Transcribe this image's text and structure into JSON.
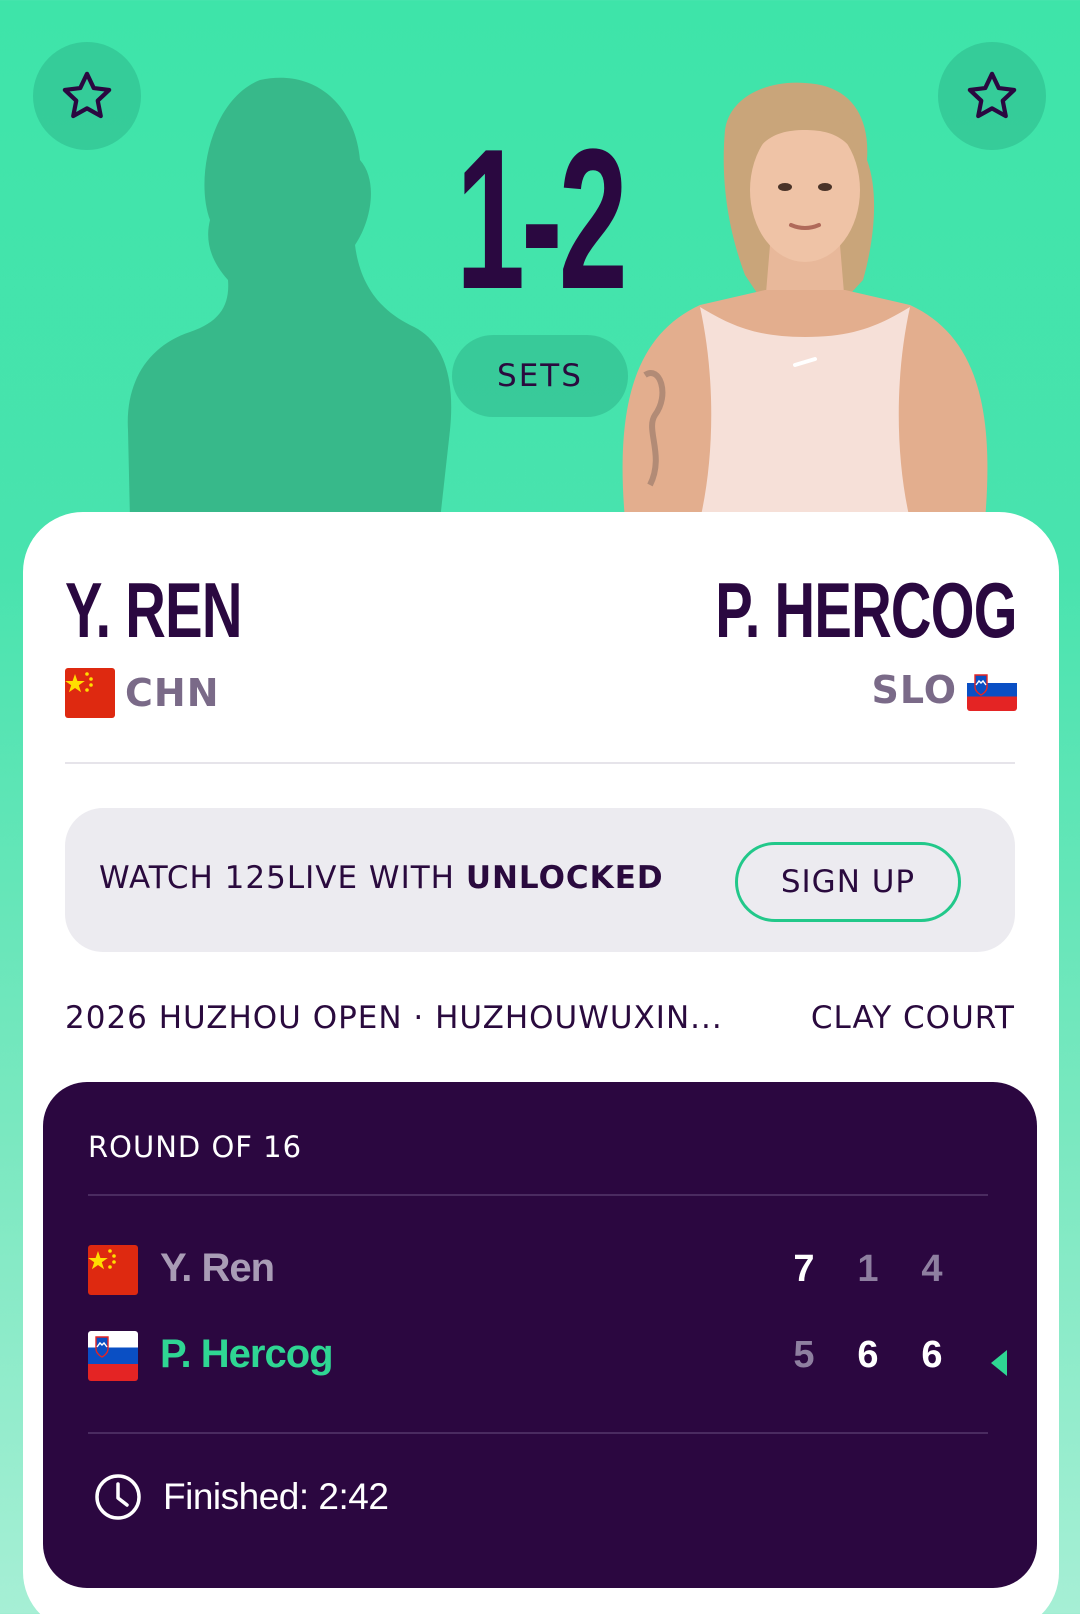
{
  "header": {
    "set_score": "1-2",
    "sets_label": "SETS"
  },
  "players": {
    "left": {
      "name": "Y. REN",
      "country_code": "CHN",
      "flag": "china-flag"
    },
    "right": {
      "name": "P. HERCOG",
      "country_code": "SLO",
      "flag": "slovenia-flag"
    }
  },
  "promo": {
    "text_prefix": "WATCH 125LIVE WITH ",
    "text_bold": "UNLOCKED",
    "button_label": "SIGN UP"
  },
  "event": {
    "name": "2026 HUZHOU OPEN · HUZHOUWUXIN...",
    "surface": "CLAY COURT"
  },
  "scoreboard": {
    "round": "ROUND OF 16",
    "rows": [
      {
        "name": "Y. Ren",
        "scores": [
          "7",
          "1",
          "4"
        ],
        "winner": false
      },
      {
        "name": "P. Hercog",
        "scores": [
          "5",
          "6",
          "6"
        ],
        "winner": true
      }
    ],
    "status": "Finished: 2:42"
  },
  "colors": {
    "accent_green": "#22c88a",
    "winner_green": "#2fd693",
    "deep_purple": "#2b0740",
    "background_mint": "#3ee4a9"
  }
}
